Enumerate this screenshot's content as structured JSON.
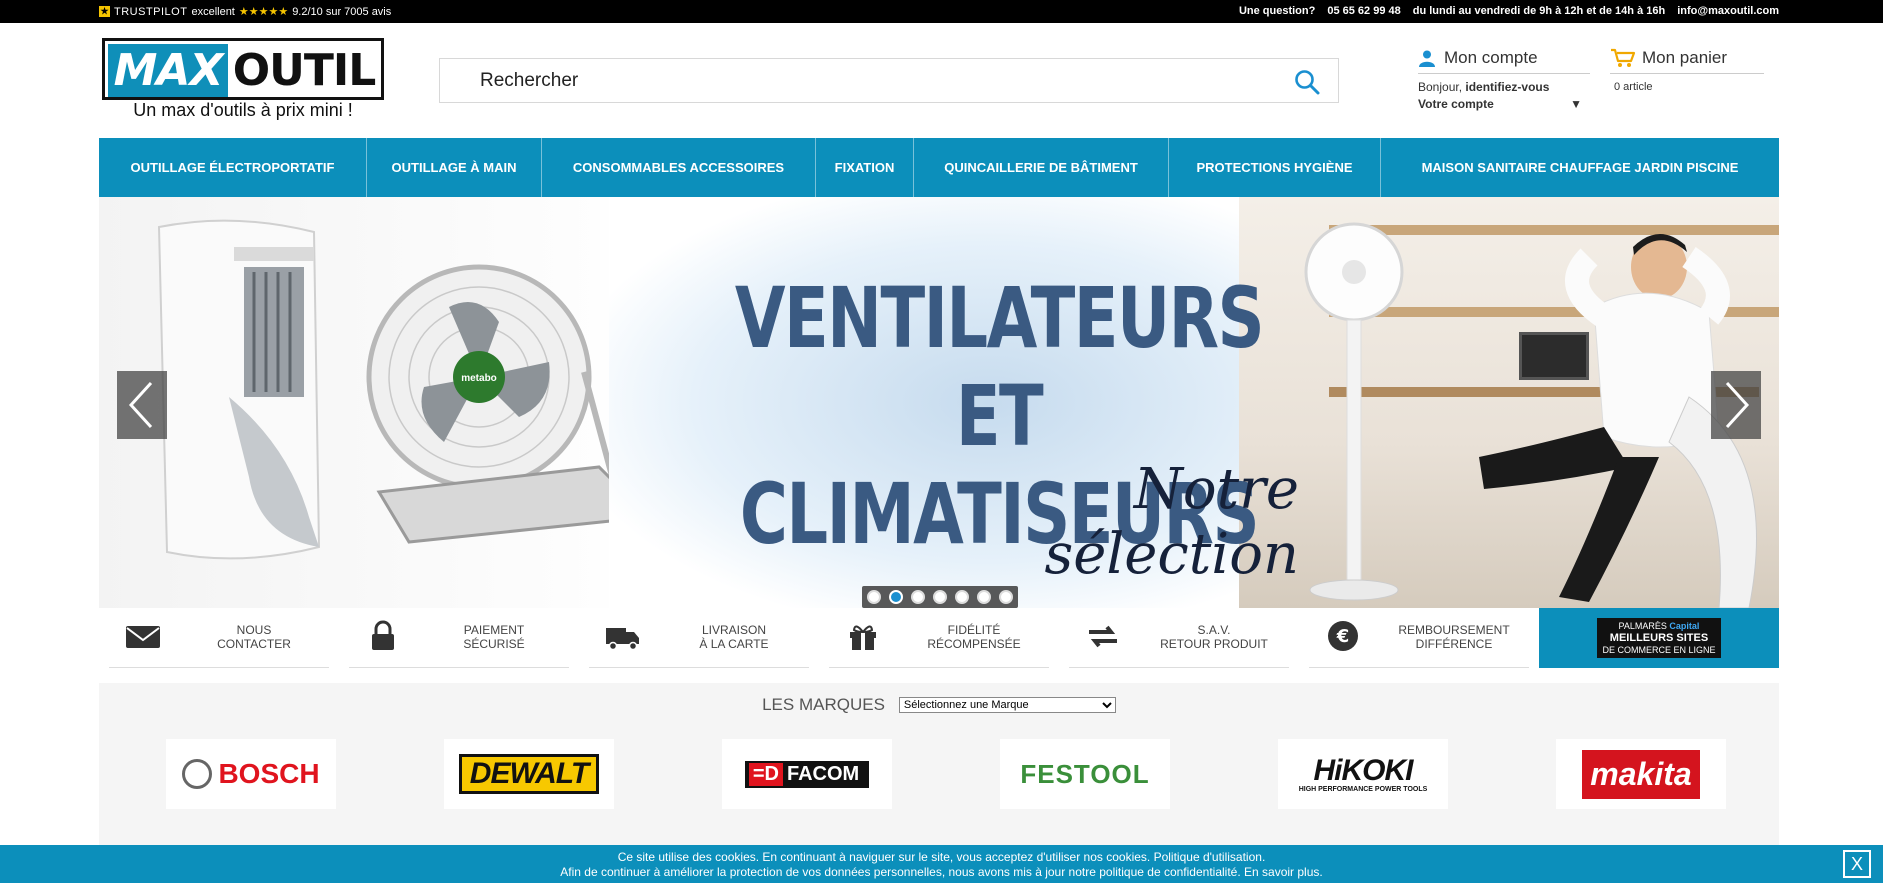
{
  "topbar": {
    "trustpilot_brand": "TRUSTPILOT",
    "trustpilot_rating_word": "excellent",
    "stars": "★★★★★",
    "score": "9.2/10 sur 7005 avis",
    "question": "Une question?",
    "phone": "05 65 62 99 48",
    "hours": "du lundi au vendredi de 9h à 12h et de 14h à 16h",
    "email": "info@maxoutil.com"
  },
  "logo": {
    "part1": "MAX",
    "part2": "OUTIL",
    "tagline": "Un max d'outils à prix mini !"
  },
  "search": {
    "placeholder": "Rechercher",
    "icon": "search-icon"
  },
  "account": {
    "title": "Mon compte",
    "greeting": "Bonjour,",
    "identify": "identifiez-vous",
    "link": "Votre compte",
    "arrow": "▼",
    "icon": "user-icon"
  },
  "cart": {
    "title": "Mon panier",
    "count": "0 article",
    "icon": "cart-icon"
  },
  "nav": [
    {
      "label": "OUTILLAGE ÉLECTROPORTATIF"
    },
    {
      "label": "OUTILLAGE À MAIN"
    },
    {
      "label": "CONSOMMABLES ACCESSOIRES"
    },
    {
      "label": "FIXATION"
    },
    {
      "label": "QUINCAILLERIE DE BÂTIMENT"
    },
    {
      "label": "PROTECTIONS HYGIÈNE"
    },
    {
      "label": "MAISON SANITAIRE CHAUFFAGE JARDIN PISCINE"
    }
  ],
  "slider": {
    "title_line1": "VENTILATEURS",
    "title_line2": "ET CLIMATISEURS",
    "subtitle": "Notre sélection",
    "fan_brand": "metabo",
    "dot_count": 7,
    "active_dot": 2
  },
  "reassurance": [
    {
      "label": "NOUS\nCONTACTER",
      "icon": "envelope-icon"
    },
    {
      "label": "PAIEMENT\nSÉCURISÉ",
      "icon": "lock-icon"
    },
    {
      "label": "LIVRAISON\nÀ LA CARTE",
      "icon": "truck-icon"
    },
    {
      "label": "FIDÉLITÉ\nRÉCOMPENSÉE",
      "icon": "gift-icon"
    },
    {
      "label": "S.A.V.\nRETOUR PRODUIT",
      "icon": "exchange-icon"
    },
    {
      "label": "REMBOURSEMENT\nDIFFÉRENCE",
      "icon": "euro-icon"
    }
  ],
  "palmares": {
    "line1": "PALMARÈS",
    "brand": "Capital",
    "line2": "MEILLEURS SITES",
    "line3": "DE COMMERCE EN LIGNE"
  },
  "brands": {
    "title": "LES MARQUES",
    "select_value": "Sélectionnez une Marque",
    "logos": [
      "BOSCH",
      "DEWALT",
      "FACOM",
      "FESTOOL",
      "HiKOKI",
      "makita"
    ],
    "hikoki_sub": "HIGH PERFORMANCE POWER TOOLS"
  },
  "cookie": {
    "line1": "Ce site utilise des cookies. En continuant à naviguer sur le site, vous acceptez d'utiliser nos cookies. Politique d'utilisation.",
    "line2": "Afin de continuer à améliorer la protection de vos données personnelles, nous avons mis à jour notre politique de confidentialité. En savoir plus.",
    "close": "X"
  },
  "colors": {
    "brand_blue": "#0c8fbb",
    "topbar": "#000000",
    "star": "#f5c400"
  }
}
